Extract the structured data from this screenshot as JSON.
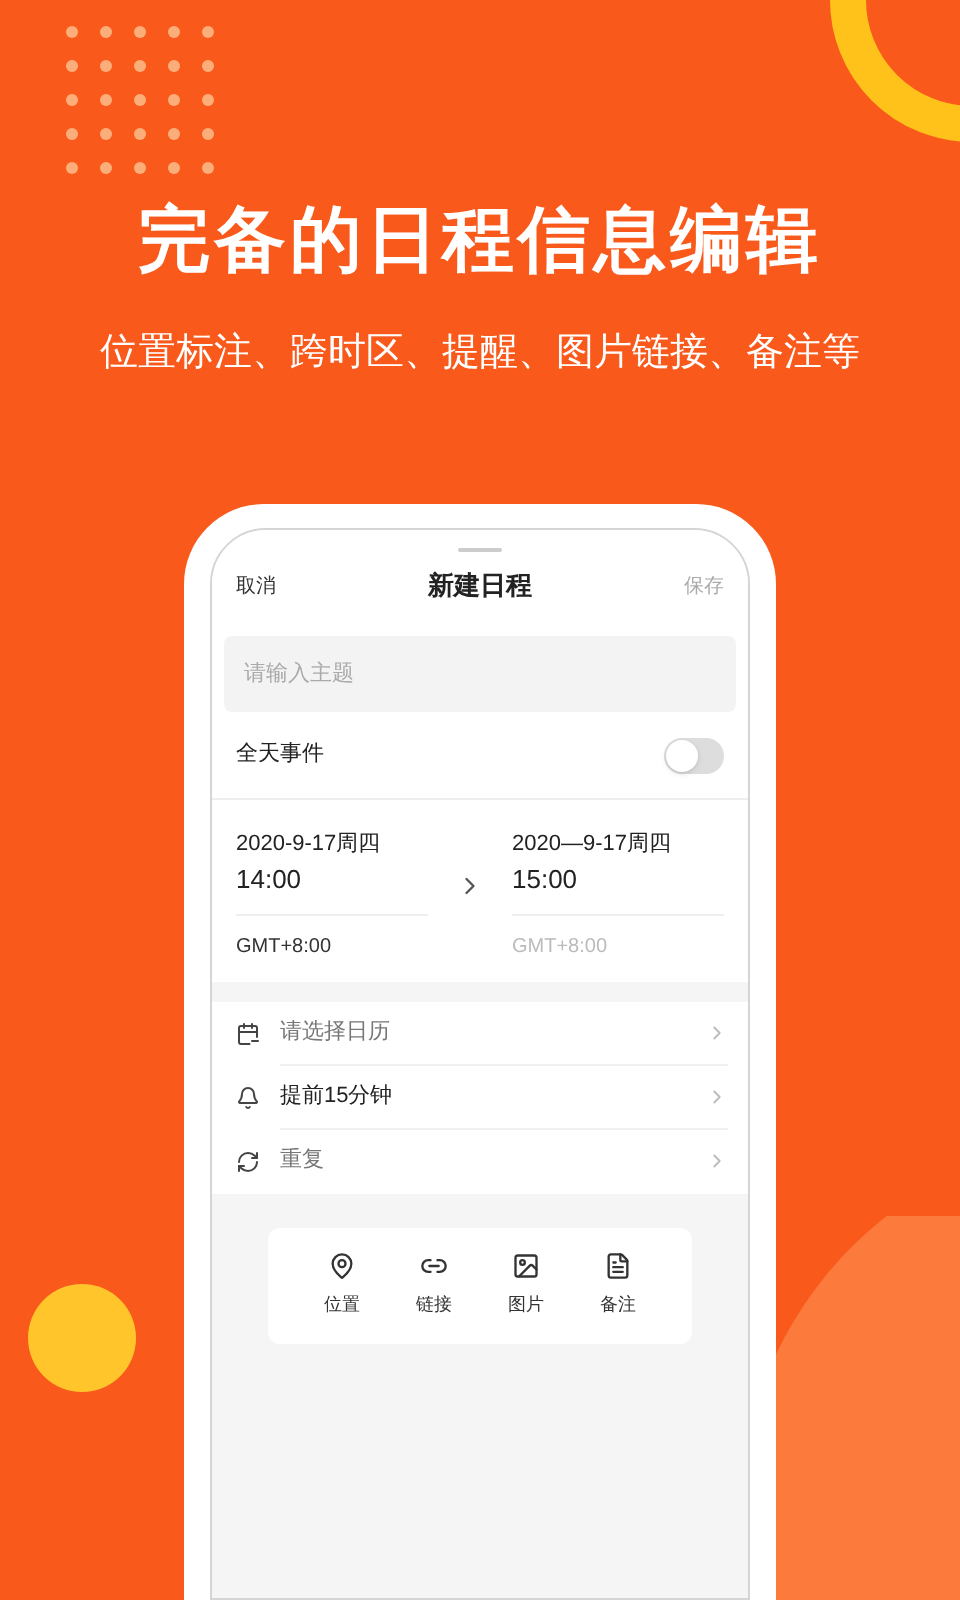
{
  "headline": "完备的日程信息编辑",
  "subtitle": "位置标注、跨时区、提醒、图片链接、备注等",
  "screen": {
    "cancel": "取消",
    "title": "新建日程",
    "save": "保存",
    "subject": {
      "placeholder": "请输入主题"
    },
    "all_day": {
      "label": "全天事件",
      "on": false
    },
    "start": {
      "date": "2020-9-17周四",
      "time": "14:00",
      "timezone": "GMT+8:00"
    },
    "end": {
      "date": "2020—9-17周四",
      "time": "15:00",
      "timezone": "GMT+8:00"
    },
    "options": [
      {
        "kind": "calendar",
        "label": "请选择日历",
        "muted": true
      },
      {
        "kind": "reminder",
        "label": "提前15分钟",
        "muted": false
      },
      {
        "kind": "repeat",
        "label": "重复",
        "muted": true
      }
    ],
    "toolbar": [
      {
        "kind": "location",
        "label": "位置"
      },
      {
        "kind": "link",
        "label": "链接"
      },
      {
        "kind": "image",
        "label": "图片"
      },
      {
        "kind": "note",
        "label": "备注"
      }
    ]
  }
}
